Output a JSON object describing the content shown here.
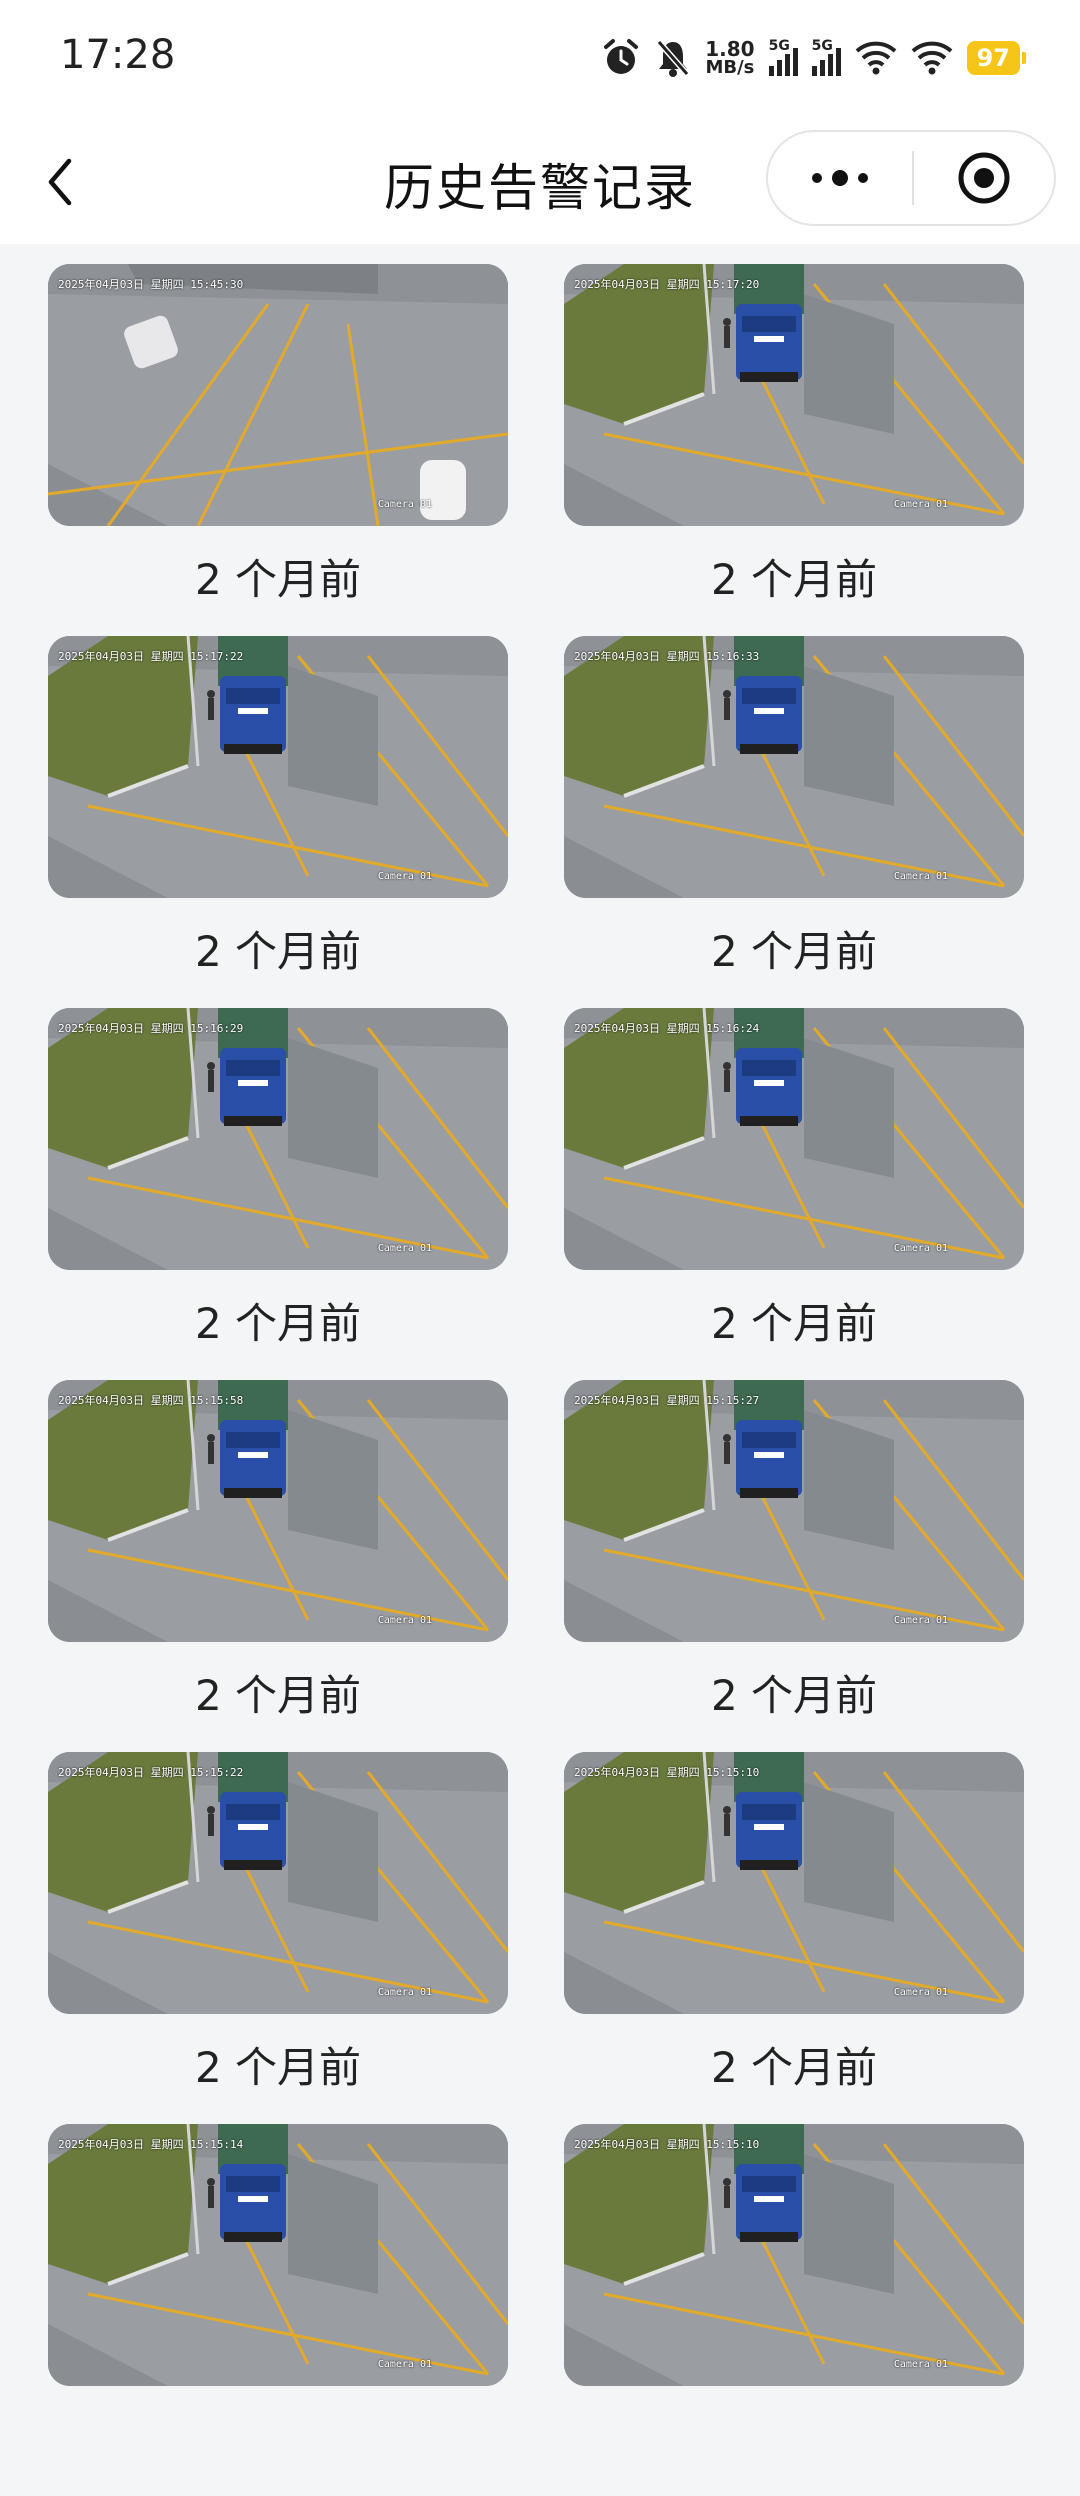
{
  "status_bar": {
    "time": "17:28",
    "net_speed_value": "1.80",
    "net_speed_unit": "MB/s",
    "sim1": "5G",
    "sim2": "5G",
    "battery": "97",
    "battery_color": "#f5c518",
    "icons": [
      "alarm-icon",
      "mute-bell-icon",
      "signal-icon",
      "wifi-icon",
      "battery-icon"
    ]
  },
  "header": {
    "title": "历史告警记录",
    "back_icon": "chevron-left-icon",
    "more_icon": "more-dots-icon",
    "close_icon": "target-circle-icon"
  },
  "records": [
    {
      "label": "2 个月前",
      "timestamp": "2025年04月03日 星期四 15:45:30",
      "camera": "Camera 01",
      "scene": "van"
    },
    {
      "label": "2 个月前",
      "timestamp": "2025年04月03日 星期四 15:17:20",
      "camera": "Camera 01",
      "scene": "truck"
    },
    {
      "label": "2 个月前",
      "timestamp": "2025年04月03日 星期四 15:17:22",
      "camera": "Camera 01",
      "scene": "truck"
    },
    {
      "label": "2 个月前",
      "timestamp": "2025年04月03日 星期四 15:16:33",
      "camera": "Camera 01",
      "scene": "truck"
    },
    {
      "label": "2 个月前",
      "timestamp": "2025年04月03日 星期四 15:16:29",
      "camera": "Camera 01",
      "scene": "truck"
    },
    {
      "label": "2 个月前",
      "timestamp": "2025年04月03日 星期四 15:16:24",
      "camera": "Camera 01",
      "scene": "truck"
    },
    {
      "label": "2 个月前",
      "timestamp": "2025年04月03日 星期四 15:15:58",
      "camera": "Camera 01",
      "scene": "truck"
    },
    {
      "label": "2 个月前",
      "timestamp": "2025年04月03日 星期四 15:15:27",
      "camera": "Camera 01",
      "scene": "truck"
    },
    {
      "label": "2 个月前",
      "timestamp": "2025年04月03日 星期四 15:15:22",
      "camera": "Camera 01",
      "scene": "truck"
    },
    {
      "label": "2 个月前",
      "timestamp": "2025年04月03日 星期四 15:15:10",
      "camera": "Camera 01",
      "scene": "truck"
    },
    {
      "label": "",
      "timestamp": "2025年04月03日 星期四 15:15:14",
      "camera": "Camera 01",
      "scene": "truck"
    },
    {
      "label": "",
      "timestamp": "2025年04月03日 星期四 15:15:10",
      "camera": "Camera 01",
      "scene": "truck"
    }
  ],
  "colors": {
    "background": "#f4f5f7",
    "header": "#ffffff",
    "road": "#9a9ea2",
    "lane_lines": "#e3a92a",
    "truck": "#2a4fa8",
    "grass": "#6a7a3c"
  }
}
